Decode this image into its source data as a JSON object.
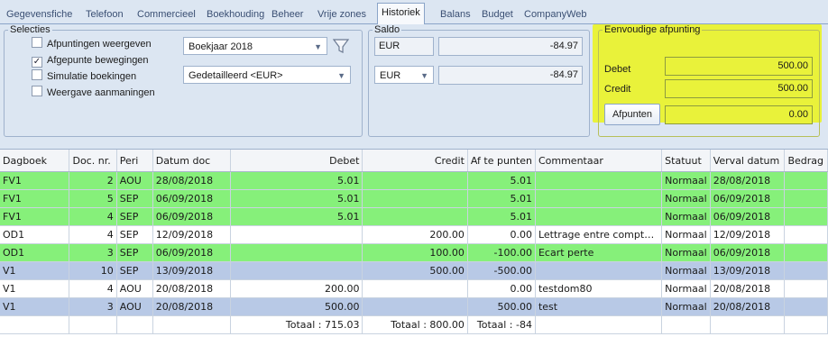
{
  "tabs": [
    {
      "label": "Gegevensfiche",
      "active": false
    },
    {
      "label": "Telefoon",
      "active": false
    },
    {
      "label": "Commercieel",
      "active": false
    },
    {
      "label": "Boekhouding",
      "active": false
    },
    {
      "label": "Beheer",
      "active": false
    },
    {
      "label": "Vrije zones",
      "active": false
    },
    {
      "label": "Historiek",
      "active": true
    },
    {
      "label": "Balans",
      "active": false
    },
    {
      "label": "Budget",
      "active": false
    },
    {
      "label": "CompanyWeb",
      "active": false
    }
  ],
  "selecties": {
    "legend": "Selecties",
    "checkboxes": [
      {
        "label": "Afpuntingen weergeven",
        "checked": false
      },
      {
        "label": "Afgepunte bewegingen",
        "checked": true
      },
      {
        "label": "Simulatie boekingen",
        "checked": false
      },
      {
        "label": "Weergave aanmaningen",
        "checked": false
      }
    ],
    "year_combo": "Boekjaar 2018",
    "detail_combo": "Gedetailleerd <EUR>"
  },
  "saldo": {
    "legend": "Saldo",
    "currency1": "EUR",
    "amount1": "-84.97",
    "currency2": "EUR",
    "amount2": "-84.97"
  },
  "afpunting": {
    "legend": "Eenvoudige afpunting",
    "debet_label": "Debet",
    "debet_value": "500.00",
    "credit_label": "Credit",
    "credit_value": "500.00",
    "button_label": "Afpunten",
    "diff_value": "0.00",
    "highlight_color": "#e9f23a"
  },
  "grid": {
    "columns": [
      "Dagboek",
      "Doc. nr.",
      "Peri",
      "Datum doc",
      "Debet",
      "Credit",
      "Af te punten",
      "Commentaar",
      "Statuut",
      "Verval datum",
      "Bedrag"
    ],
    "rows": [
      {
        "style": "green",
        "cells": [
          "FV1",
          "2",
          "AOU",
          "28/08/2018",
          "5.01",
          "",
          "5.01",
          "",
          "Normaal",
          "28/08/2018",
          ""
        ]
      },
      {
        "style": "green",
        "cells": [
          "FV1",
          "5",
          "SEP",
          "06/09/2018",
          "5.01",
          "",
          "5.01",
          "",
          "Normaal",
          "06/09/2018",
          ""
        ]
      },
      {
        "style": "green",
        "cells": [
          "FV1",
          "4",
          "SEP",
          "06/09/2018",
          "5.01",
          "",
          "5.01",
          "",
          "Normaal",
          "06/09/2018",
          ""
        ]
      },
      {
        "style": "white",
        "cells": [
          "OD1",
          "4",
          "SEP",
          "12/09/2018",
          "",
          "200.00",
          "0.00",
          "Lettrage entre compt…",
          "Normaal",
          "12/09/2018",
          ""
        ]
      },
      {
        "style": "green",
        "cells": [
          "OD1",
          "3",
          "SEP",
          "06/09/2018",
          "",
          "100.00",
          "-100.00",
          "Ecart perte",
          "Normaal",
          "06/09/2018",
          ""
        ]
      },
      {
        "style": "blue",
        "cells": [
          "V1",
          "10",
          "SEP",
          "13/09/2018",
          "",
          "500.00",
          "-500.00",
          "",
          "Normaal",
          "13/09/2018",
          ""
        ]
      },
      {
        "style": "white",
        "cells": [
          "V1",
          "4",
          "AOU",
          "20/08/2018",
          "200.00",
          "",
          "0.00",
          "testdom80",
          "Normaal",
          "20/08/2018",
          ""
        ]
      },
      {
        "style": "blue",
        "cells": [
          "V1",
          "3",
          "AOU",
          "20/08/2018",
          "500.00",
          "",
          "500.00",
          "test",
          "Normaal",
          "20/08/2018",
          ""
        ]
      },
      {
        "style": "total",
        "cells": [
          "",
          "",
          "",
          "",
          "Totaal : 715.03",
          "Totaal : 800.00",
          "Totaal : -84",
          "",
          "",
          "",
          ""
        ]
      }
    ],
    "row_colors": {
      "green": "#86f07a",
      "blue": "#b8c9e6",
      "white": "#ffffff"
    }
  }
}
